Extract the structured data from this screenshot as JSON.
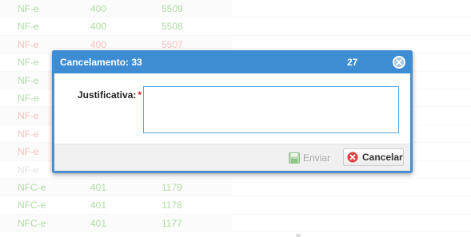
{
  "rows": [
    {
      "type": "NF-e",
      "series": "400",
      "number": "5509",
      "status": "ok"
    },
    {
      "type": "NF-e",
      "series": "400",
      "number": "5508",
      "status": "ok"
    },
    {
      "type": "NF-e",
      "series": "400",
      "number": "5507",
      "status": "cancel"
    },
    {
      "type": "NF-e",
      "series": "",
      "number": "",
      "status": "ok"
    },
    {
      "type": "NF-e",
      "series": "",
      "number": "",
      "status": "ok"
    },
    {
      "type": "NF-e",
      "series": "",
      "number": "",
      "status": "ok"
    },
    {
      "type": "NF-e",
      "series": "",
      "number": "",
      "status": "cancel"
    },
    {
      "type": "NF-e",
      "series": "",
      "number": "",
      "status": "cancel"
    },
    {
      "type": "NF-e",
      "series": "",
      "number": "",
      "status": "cancel"
    },
    {
      "type": "NF-e",
      "series": "",
      "number": "",
      "status": "other"
    },
    {
      "type": "NFC-e",
      "series": "401",
      "number": "1179",
      "status": "ok"
    },
    {
      "type": "NFC-e",
      "series": "401",
      "number": "1178",
      "status": "ok"
    },
    {
      "type": "NFC-e",
      "series": "401",
      "number": "1177",
      "status": "ok"
    }
  ],
  "status_colors": {
    "ok": "#86c974",
    "cancel": "#f29a9a",
    "other": "#d4d4d4"
  },
  "dialog": {
    "title": "Cancelamento: 33",
    "count": "27",
    "field_label": "Justificativa:",
    "required_mark": "*",
    "field_value": "",
    "send_label": "Enviar",
    "cancel_label": "Cancelar",
    "header_color": "#3e8dd2"
  }
}
